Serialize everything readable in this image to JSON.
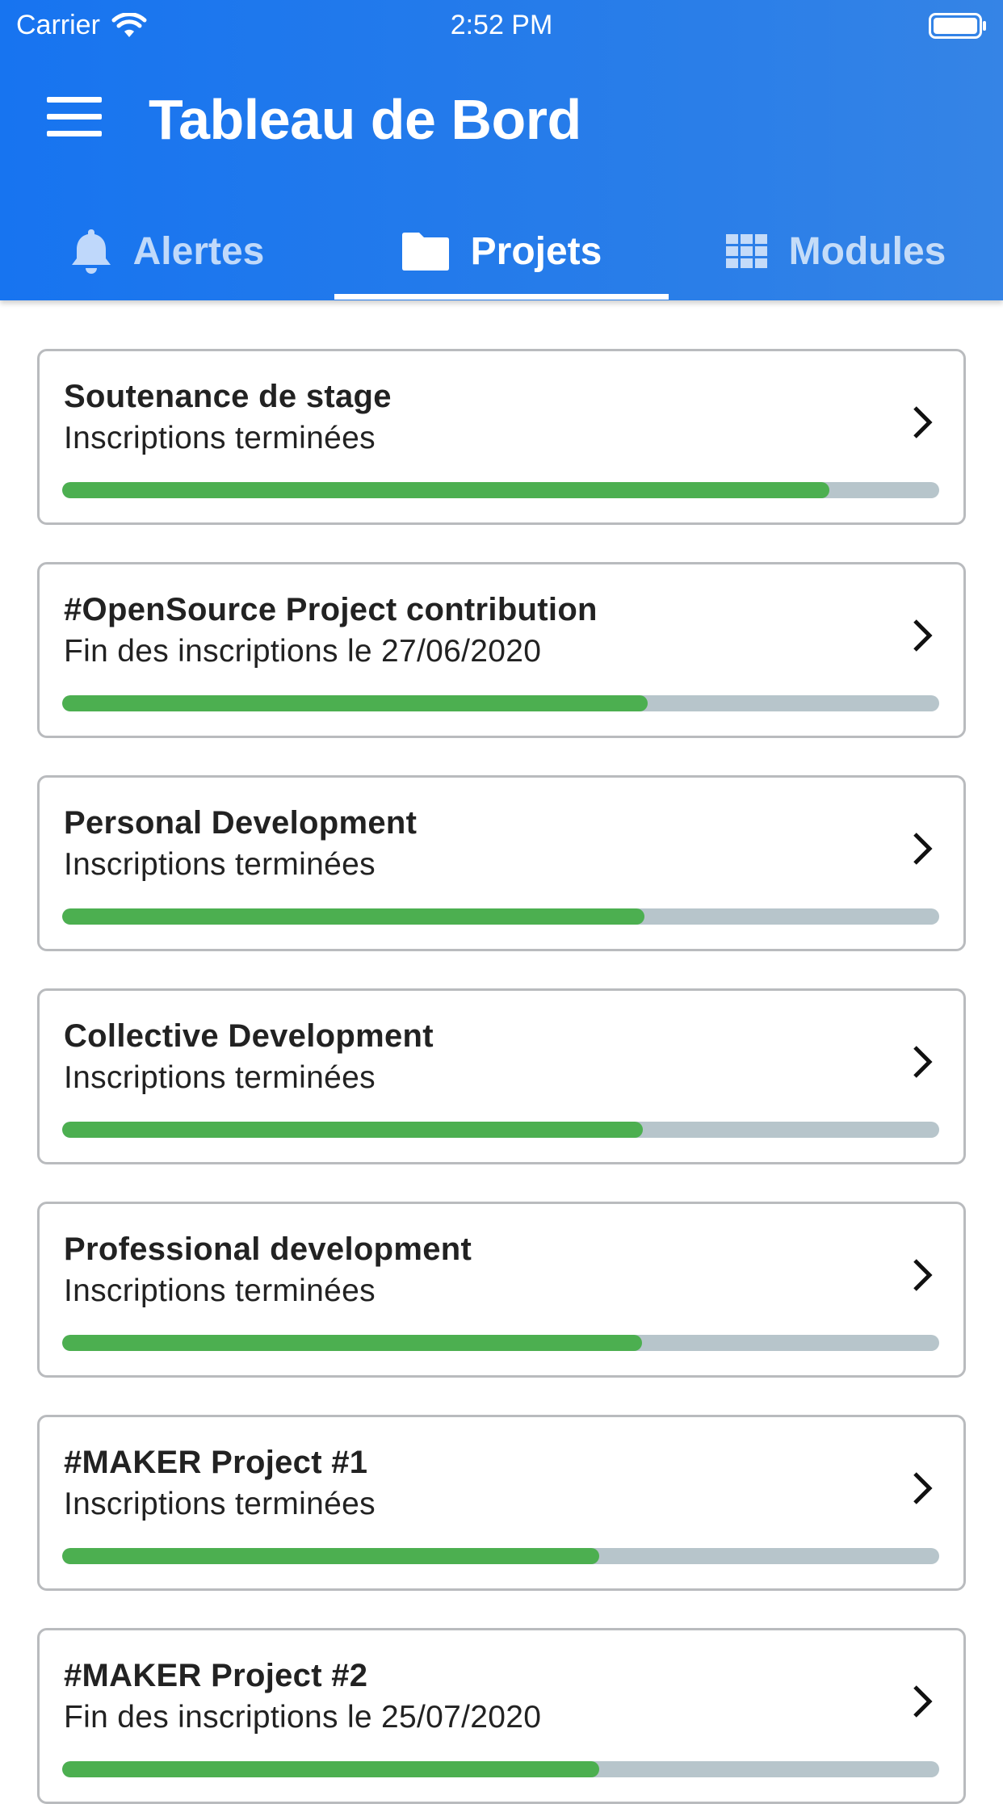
{
  "status_bar": {
    "carrier": "Carrier",
    "time": "2:52 PM"
  },
  "header": {
    "title": "Tableau de Bord"
  },
  "tabs": [
    {
      "label": "Alertes",
      "icon": "bell-icon",
      "active": false
    },
    {
      "label": "Projets",
      "icon": "folder-icon",
      "active": true
    },
    {
      "label": "Modules",
      "icon": "grid-icon",
      "active": false
    }
  ],
  "colors": {
    "header": "#1774f0",
    "progress_fill": "#4caf50",
    "progress_track": "#b7c5cb"
  },
  "projects": [
    {
      "title": "Soutenance de stage",
      "subtitle": "Inscriptions terminées",
      "progress": 0.875
    },
    {
      "title": "#OpenSource Project contribution",
      "subtitle": "Fin des inscriptions le 27/06/2020",
      "progress": 0.668
    },
    {
      "title": "Personal Development",
      "subtitle": "Inscriptions terminées",
      "progress": 0.664
    },
    {
      "title": "Collective Development",
      "subtitle": "Inscriptions terminées",
      "progress": 0.662
    },
    {
      "title": "Professional development",
      "subtitle": "Inscriptions terminées",
      "progress": 0.661
    },
    {
      "title": "#MAKER Project #1",
      "subtitle": "Inscriptions terminées",
      "progress": 0.612
    },
    {
      "title": "#MAKER Project #2",
      "subtitle": "Fin des inscriptions le 25/07/2020",
      "progress": 0.612
    }
  ]
}
